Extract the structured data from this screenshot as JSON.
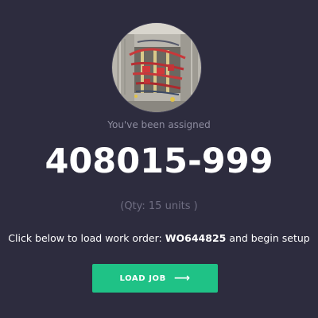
{
  "assignment": {
    "assigned_text": "You've been assigned",
    "part_number": "408015-999",
    "quantity_text": "(Qty: 15 units )",
    "instruction_prefix": "Click below to load work order: ",
    "work_order": "WO644825",
    "instruction_suffix": " and begin setup"
  },
  "actions": {
    "load_job_label": "LOAD JOB",
    "load_job_icon": "arrow-right-icon",
    "load_job_arrow": "⟶"
  },
  "colors": {
    "background": "#2d2c3e",
    "accent": "#1fc286",
    "muted_text": "#8e8da0"
  }
}
